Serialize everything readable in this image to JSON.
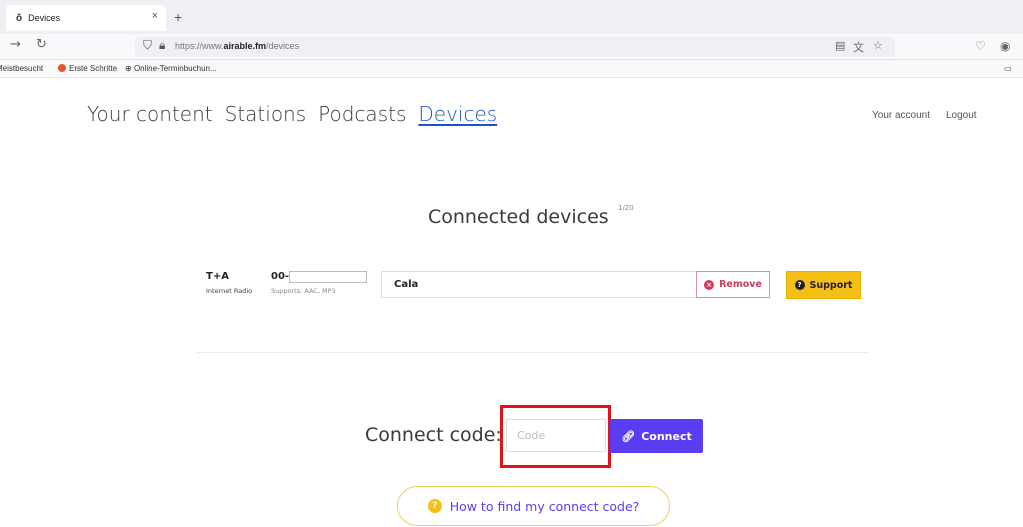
{
  "browser": {
    "tab_title": "Devices",
    "tab_favicon": "ŏ",
    "tab_close": "×",
    "new_tab": "+",
    "url_prefix": "https://www.",
    "url_domain": "airable.fm",
    "url_path": "/devices",
    "bookmarks": [
      "Meistbesucht",
      "Erste Schritte",
      "Online-Terminbuchun..."
    ]
  },
  "nav": {
    "items": [
      "Your content",
      "Stations",
      "Podcasts",
      "Devices"
    ],
    "active": "Devices",
    "account": "Your account",
    "logout": "Logout"
  },
  "devices": {
    "heading": "Connected devices",
    "count": "1/20",
    "list": [
      {
        "brand": "T+A",
        "type": "Internet Radio",
        "id_prefix": "00-",
        "supports": "Supports: AAC, MP3",
        "name": "Cala",
        "remove_label": "Remove",
        "support_label": "Support"
      }
    ]
  },
  "connect": {
    "label": "Connect code:",
    "placeholder": "Code",
    "button": "Connect",
    "help": "How to find my connect code?"
  },
  "colors": {
    "accent": "#5a3df2",
    "link": "#1a54c9",
    "support": "#f4bf16",
    "remove": "#d23a5f",
    "highlight": "#e3131a"
  }
}
